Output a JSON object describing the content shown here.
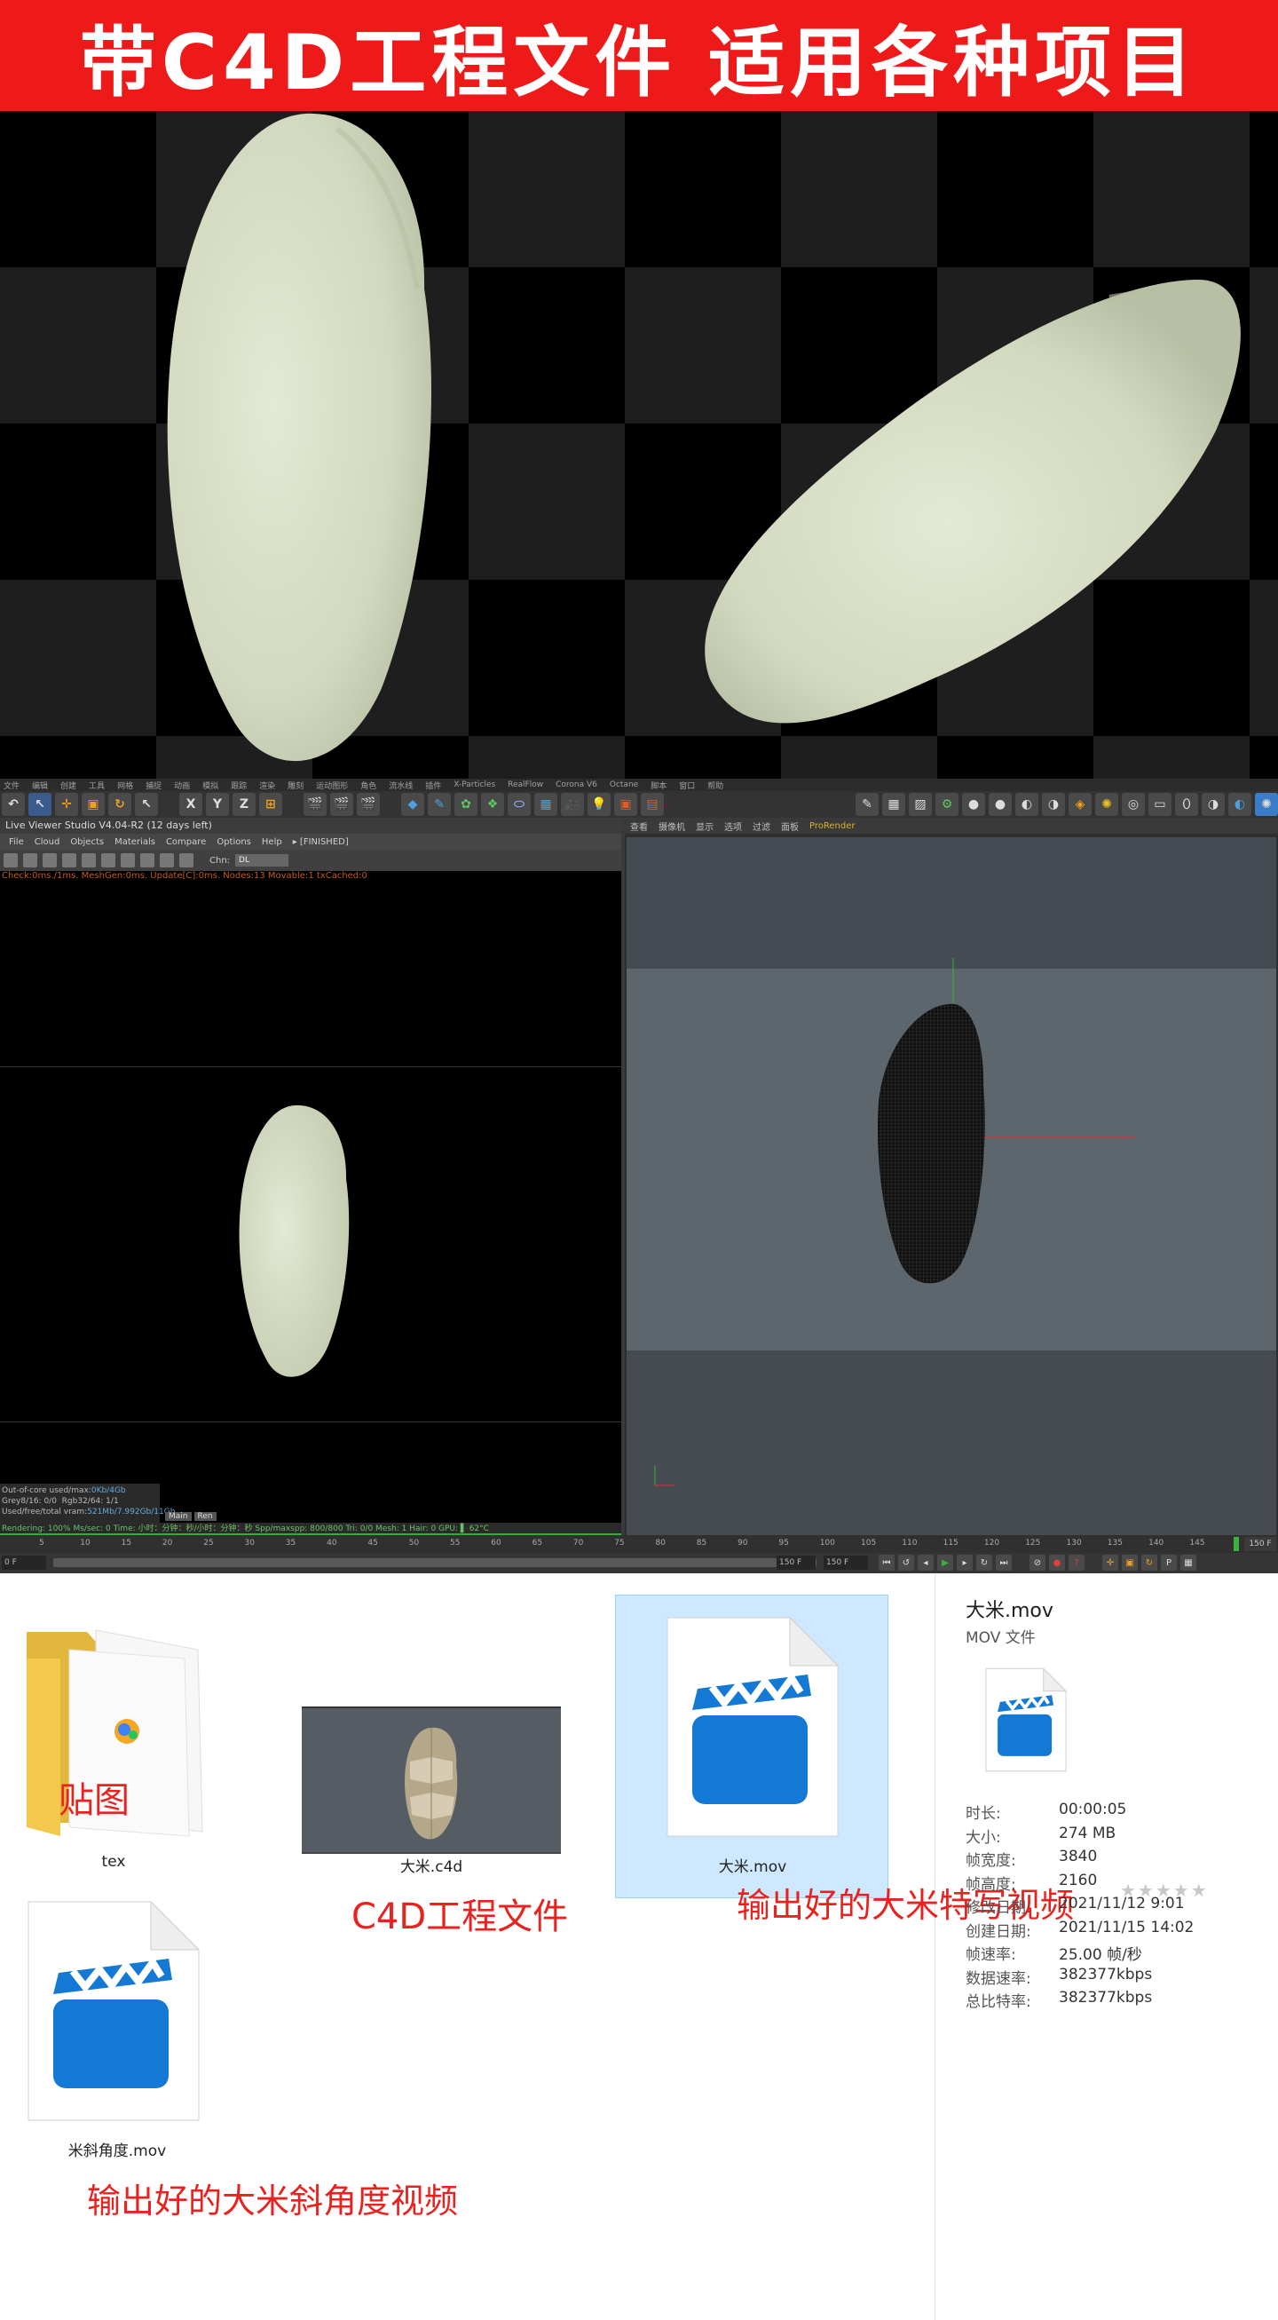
{
  "banner": {
    "title": "带C4D工程文件 适用各种项目"
  },
  "c4d": {
    "menubar": [
      "文件",
      "编辑",
      "创建",
      "工具",
      "网格",
      "捕捉",
      "动画",
      "模拟",
      "跟踪",
      "渲染",
      "雕刻",
      "运动图形",
      "角色",
      "流水线",
      "插件",
      "X-Particles",
      "RealFlow",
      "Corona V6",
      "Octane",
      "脚本",
      "窗口",
      "帮助"
    ],
    "toolbar_labels": {
      "x": "X",
      "y": "Y",
      "z": "Z"
    },
    "live_viewer": {
      "title": "Live Viewer Studio V4.04-R2 (12 days left)",
      "menu": [
        "File",
        "Cloud",
        "Objects",
        "Materials",
        "Compare",
        "Options",
        "Help",
        "▸ [FINISHED]"
      ],
      "chn_label": "Chn:",
      "chn_value": "DL",
      "status": "Check:0ms./1ms. MeshGen:0ms. Update[C]:0ms. Nodes:13 Movable:1 txCached:0",
      "stats": [
        {
          "k": "Out-of-core used/max:",
          "v": "0Kb/4Gb"
        },
        {
          "k": "Grey8/16: 0/0",
          "v": "Rgb32/64: 1/1"
        },
        {
          "k": "Used/free/total vram:",
          "v": "521Mb/7.992Gb/11Gb"
        }
      ],
      "stats_tabs": [
        "Main",
        "Ren"
      ],
      "footer": "Rendering: 100%   Ms/sec: 0   Time: 小时：分钟：秒/小时：分钟：秒   Spp/maxspp: 800/800   Tri: 0/0   Mesh: 1   Hair: 0   GPU: ▌ 62°C"
    },
    "viewport": {
      "menu": [
        "查看",
        "摄像机",
        "显示",
        "选项",
        "过滤",
        "面板"
      ],
      "prorender": "ProRender"
    },
    "timeline": {
      "ticks": [
        "5",
        "10",
        "15",
        "20",
        "25",
        "30",
        "35",
        "40",
        "45",
        "50",
        "55",
        "60",
        "65",
        "70",
        "75",
        "80",
        "85",
        "90",
        "95",
        "100",
        "105",
        "110",
        "115",
        "120",
        "125",
        "130",
        "135",
        "140",
        "145"
      ],
      "end_label": "150 F",
      "start_field": "0 F",
      "frame_field_1": "150 F",
      "frame_field_2": "150 F"
    }
  },
  "explorer": {
    "files": [
      {
        "name": "tex",
        "caption": "贴图"
      },
      {
        "name": "大米.c4d",
        "caption": "C4D工程文件"
      },
      {
        "name": "大米.mov",
        "caption": "输出好的大米特写视频"
      },
      {
        "name": "米斜角度.mov",
        "caption": "输出好的大米斜角度视频"
      }
    ],
    "details": {
      "title": "大米.mov",
      "type": "MOV 文件",
      "rows": [
        {
          "k": "时长:",
          "v": "00:00:05"
        },
        {
          "k": "大小:",
          "v": "274 MB"
        },
        {
          "k": "帧宽度:",
          "v": "3840"
        },
        {
          "k": "帧高度:",
          "v": "2160"
        },
        {
          "k": "修改日期:",
          "v": "2021/11/12 9:01"
        },
        {
          "k": "创建日期:",
          "v": "2021/11/15 14:02"
        },
        {
          "k": "帧速率:",
          "v": "25.00 帧/秒"
        },
        {
          "k": "数据速率:",
          "v": "382377kbps"
        },
        {
          "k": "总比特率:",
          "v": "382377kbps"
        }
      ],
      "rating": "★★★★★"
    }
  },
  "colors": {
    "banner_red": "#ee1a1a",
    "caption_red": "#e8231f",
    "rice": "#d8dfc6",
    "c4d_dark": "#3a3a3a",
    "selected_blue": "#cde8ff",
    "clapper_blue": "#1479d4"
  }
}
